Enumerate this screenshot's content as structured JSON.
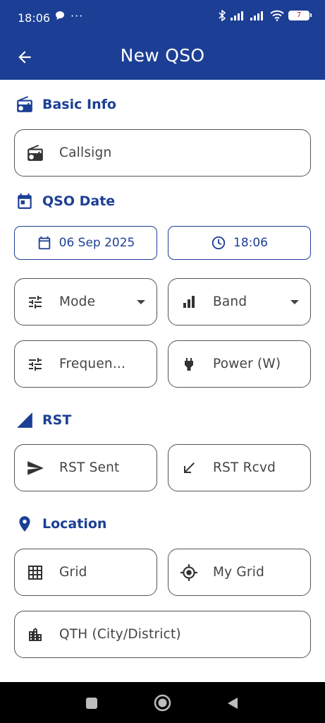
{
  "status_bar": {
    "time": "18:06",
    "dots": "···",
    "battery": "7"
  },
  "app_bar": {
    "title": "New QSO"
  },
  "sections": {
    "basic_info": "Basic Info",
    "qso_date": "QSO Date",
    "rst": "RST",
    "location": "Location"
  },
  "fields": {
    "callsign": "Callsign",
    "date": "06 Sep 2025",
    "time": "18:06",
    "mode": "Mode",
    "band": "Band",
    "frequency": "Frequen...",
    "power": "Power (W)",
    "rst_sent": "RST Sent",
    "rst_rcvd": "RST Rcvd",
    "grid": "Grid",
    "my_grid": "My Grid",
    "qth": "QTH (City/District)"
  },
  "colors": {
    "primary": "#1c3f95",
    "outline": "#555555",
    "battery_text": "#c0182b"
  },
  "icons": [
    "back-arrow-icon",
    "radio-icon",
    "calendar-icon",
    "clock-icon",
    "tune-icon",
    "signal-bars-icon",
    "plug-icon",
    "send-icon",
    "arrow-down-left-icon",
    "location-pin-icon",
    "grid-icon",
    "crosshair-icon",
    "city-icon"
  ]
}
